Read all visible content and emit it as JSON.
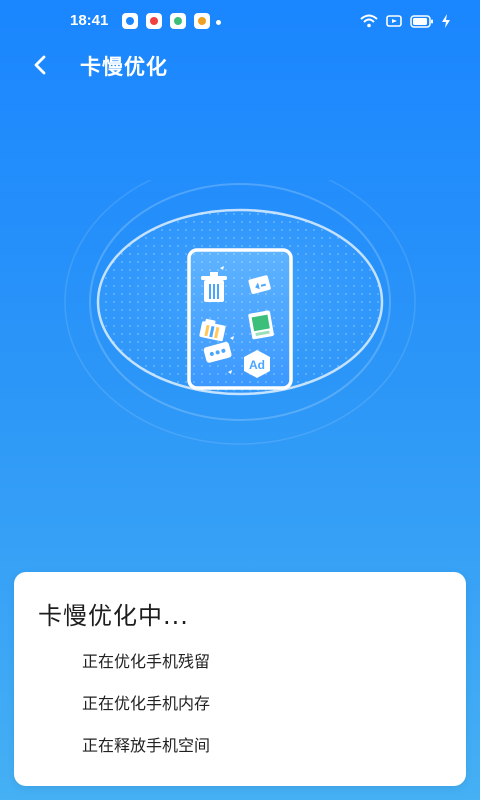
{
  "status_bar": {
    "time": "18:41",
    "notification_icons": [
      {
        "name": "app-notification-icon",
        "color": "#1a86ff"
      },
      {
        "name": "message-notification-icon",
        "color": "#f04040"
      },
      {
        "name": "game-notification-icon",
        "color": "#3bbf7a"
      },
      {
        "name": "shop-notification-icon",
        "color": "#f0a020"
      }
    ],
    "icons": [
      "wifi-icon",
      "cast-icon",
      "battery-icon",
      "charging-icon"
    ]
  },
  "header": {
    "back_icon": "chevron-left-icon",
    "title": "卡慢优化"
  },
  "illustration": {
    "items": [
      "trash-icon",
      "file-icon",
      "folder-icon",
      "image-file-icon",
      "chat-icon",
      "ad-icon"
    ],
    "ad_label": "Ad"
  },
  "progress_card": {
    "title": "卡慢优化中...",
    "tasks": [
      "正在优化手机残留",
      "正在优化手机内存",
      "正在释放手机空间"
    ]
  },
  "colors": {
    "background_top": "#1a86ff",
    "background_bottom": "#45b0f4",
    "card": "#ffffff",
    "text": "#1d1d1d"
  }
}
